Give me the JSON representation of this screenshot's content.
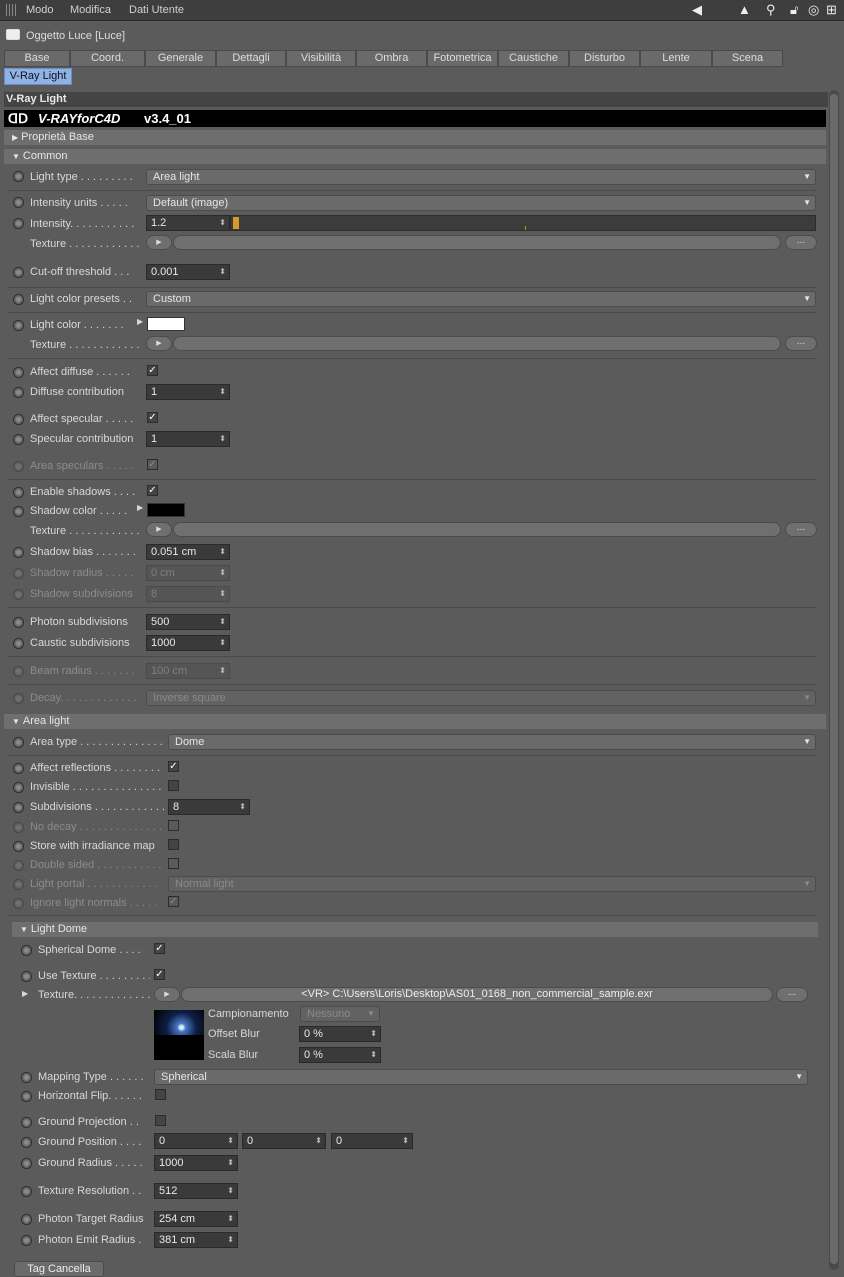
{
  "menu": {
    "items": [
      "Modo",
      "Modifica",
      "Dati Utente"
    ]
  },
  "object_title": "Oggetto Luce [Luce]",
  "tabs": [
    "Base",
    "Coord.",
    "Generale",
    "Dettagli",
    "Visibilità",
    "Ombra",
    "Fotometrica",
    "Caustiche",
    "Disturbo",
    "Lente",
    "Scena"
  ],
  "active_tab": "V-Ray Light",
  "section_title": "V-Ray Light",
  "banner": {
    "logo": "V-RAYforC4D",
    "version": "v3.4_01"
  },
  "groups": {
    "base": "Proprietà Base",
    "common": "Common",
    "area": "Area light",
    "dome": "Light Dome"
  },
  "common": {
    "light_type": {
      "label": "Light type . . . . . . . . .",
      "value": "Area light"
    },
    "intensity_units": {
      "label": "Intensity units . . . . .",
      "value": "Default (image)"
    },
    "intensity": {
      "label": "Intensity. . . . . . . . . . .",
      "value": "1.2"
    },
    "texture1": {
      "label": "Texture . . . . . . . . . . . ."
    },
    "cutoff": {
      "label": "Cut-off threshold . . .",
      "value": "0.001"
    },
    "color_presets": {
      "label": "Light color presets . .",
      "value": "Custom"
    },
    "light_color": {
      "label": "Light color . . . . . . .",
      "value": "#ffffff"
    },
    "texture2": {
      "label": "Texture . . . . . . . . . . . ."
    },
    "affect_diffuse": {
      "label": "Affect diffuse . . . . . .",
      "checked": true
    },
    "diffuse_contribution": {
      "label": "Diffuse contribution",
      "value": "1"
    },
    "affect_specular": {
      "label": "Affect specular . . . . .",
      "checked": true
    },
    "specular_contribution": {
      "label": "Specular contribution",
      "value": "1"
    },
    "area_speculars": {
      "label": "Area speculars . . . . .",
      "checked": true
    },
    "enable_shadows": {
      "label": "Enable shadows . . . .",
      "checked": true
    },
    "shadow_color": {
      "label": "Shadow color . . . . .",
      "value": "#000000"
    },
    "texture3": {
      "label": "Texture . . . . . . . . . . . ."
    },
    "shadow_bias": {
      "label": "Shadow bias . . . . . . .",
      "value": "0.051 cm"
    },
    "shadow_radius": {
      "label": "Shadow radius . . . . .",
      "value": "0 cm"
    },
    "shadow_subdivisions": {
      "label": "Shadow subdivisions",
      "value": "8"
    },
    "photon_subdivisions": {
      "label": "Photon subdivisions",
      "value": "500"
    },
    "caustic_subdivisions": {
      "label": "Caustic subdivisions",
      "value": "1000"
    },
    "beam_radius": {
      "label": "Beam radius . . . . . . .",
      "value": "100 cm"
    },
    "decay": {
      "label": "Decay. . . . . . . . . . . . .",
      "value": "Inverse square"
    }
  },
  "area": {
    "area_type": {
      "label": "Area type . . . . . . . . . . . . . .",
      "value": "Dome"
    },
    "affect_reflections": {
      "label": "Affect reflections . . . . . . . .",
      "checked": true
    },
    "invisible": {
      "label": "Invisible . . . . . . . . . . . . . . .",
      "checked": false
    },
    "subdivisions": {
      "label": "Subdivisions . . . . . . . . . . . .",
      "value": "8"
    },
    "no_decay": {
      "label": "No decay . . . . . . . . . . . . . .",
      "checked": false
    },
    "store_irradiance": {
      "label": "Store with irradiance map",
      "checked": false
    },
    "double_sided": {
      "label": "Double sided . . . . . . . . . . .",
      "checked": false
    },
    "light_portal": {
      "label": "Light portal . . . . . . . . . . . .",
      "value": "Normal light"
    },
    "ignore_normals": {
      "label": "Ignore light normals . . . . .",
      "checked": true
    }
  },
  "dome": {
    "spherical_dome": {
      "label": "Spherical Dome . . . .",
      "checked": true
    },
    "use_texture": {
      "label": "Use Texture . . . . . . . . .",
      "checked": true
    },
    "texture": {
      "label": "Texture. . . . . . . . . . . . .",
      "path": "<VR> C:\\Users\\Loris\\Desktop\\AS01_0168_non_commercial_sample.exr"
    },
    "campionamento": {
      "label": "Campionamento",
      "value": "Nessuno"
    },
    "offset_blur": {
      "label": "Offset Blur",
      "value": "0 %"
    },
    "scala_blur": {
      "label": "Scala Blur",
      "value": "0 %"
    },
    "mapping_type": {
      "label": "Mapping Type . . . . . .",
      "value": "Spherical"
    },
    "horizontal_flip": {
      "label": "Horizontal Flip. . . . . .",
      "checked": false
    },
    "ground_projection": {
      "label": "Ground Projection . .",
      "checked": false
    },
    "ground_position": {
      "label": "Ground Position . . . .",
      "x": "0",
      "y": "0",
      "z": "0"
    },
    "ground_radius": {
      "label": "Ground Radius . . . . .",
      "value": "1000"
    },
    "texture_resolution": {
      "label": "Texture Resolution . .",
      "value": "512"
    },
    "photon_target_radius": {
      "label": "Photon Target Radius",
      "value": "254 cm"
    },
    "photon_emit_radius": {
      "label": "Photon Emit Radius .",
      "value": "381 cm"
    }
  },
  "bottom_button": "Tag Cancella",
  "colors": {
    "accent_tab": "#8fb2e6",
    "slider_marker": "#d79a2b"
  }
}
